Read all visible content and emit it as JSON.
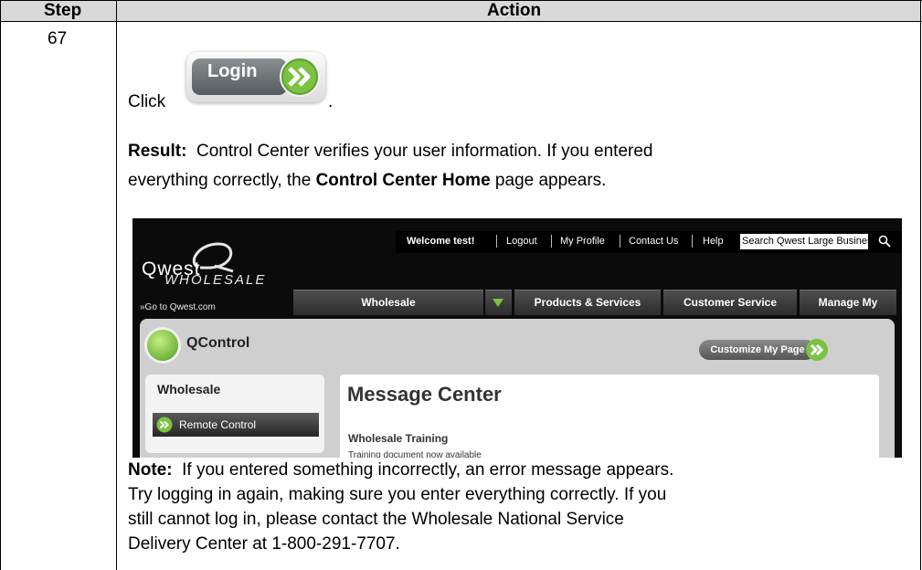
{
  "table": {
    "col_step": "Step",
    "col_action": "Action",
    "step_number": "67"
  },
  "instruction": {
    "click_word": "Click",
    "period": ".",
    "login_button_label": "Login",
    "result_label": "Result:",
    "result_text_1": "Control Center verifies your user information.  If you entered",
    "result_text_2a": "everything correctly, the ",
    "result_text_2b": "Control Center Home",
    "result_text_2c": " page appears.",
    "note_label": "Note:",
    "note_text_1": "If you entered something incorrectly, an error message appears.",
    "note_text_2": "Try logging in again, making sure you enter everything correctly.  If you",
    "note_text_3": "still cannot log in, please contact the Wholesale National Service",
    "note_text_4": "Delivery Center at 1-800-291-7707."
  },
  "screenshot": {
    "welcome": "Welcome test!",
    "logout": "Logout",
    "my_profile": "My Profile",
    "contact_us": "Contact Us",
    "help": "Help",
    "search_value": "Search Qwest Large Busines",
    "logo_main": "Qwest",
    "logo_sub": "WHOLESALE",
    "goto_link": "»Go to Qwest.com",
    "nav": {
      "wholesale": "Wholesale",
      "products": "Products & Services",
      "customer_service": "Customer Service",
      "manage_account": "Manage My Account"
    },
    "qcontrol_title": "QControl",
    "customize_label": "Customize My Page",
    "side_title": "Wholesale",
    "remote_control": "Remote Control",
    "message_center_title": "Message Center",
    "wholesale_training": "Wholesale Training",
    "training_doc": "Training document now available"
  },
  "colors": {
    "accent_green": "#7cc242",
    "header_gray": "#d9d9d9"
  }
}
